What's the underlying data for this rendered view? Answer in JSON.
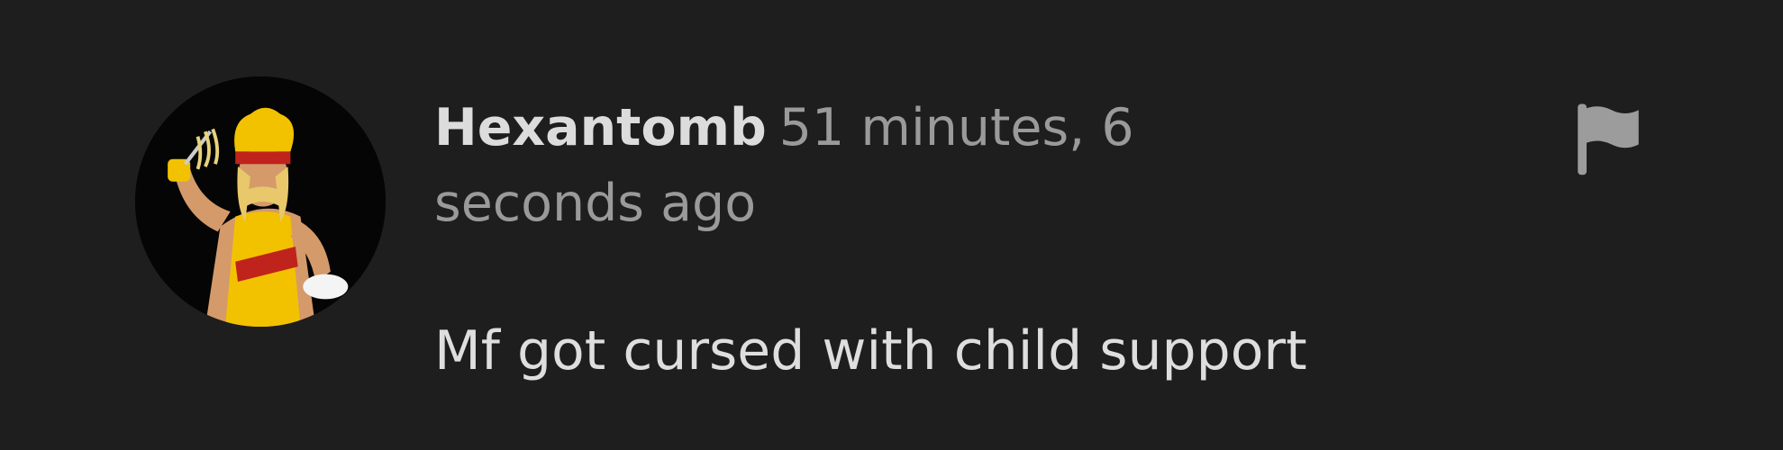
{
  "comment": {
    "username": "Hexantomb",
    "timestamp": "51 minutes, 6 seconds ago",
    "body": "Mf got cursed with child support"
  },
  "icons": {
    "flag": "flag-icon",
    "avatar": "avatar-image"
  },
  "colors": {
    "background": "#1e1e1e",
    "username": "#dcdcdc",
    "timestamp": "#9a9a9a",
    "body": "#dedede",
    "flag": "#9c9c9c",
    "avatar_accent": "#f2c200"
  }
}
